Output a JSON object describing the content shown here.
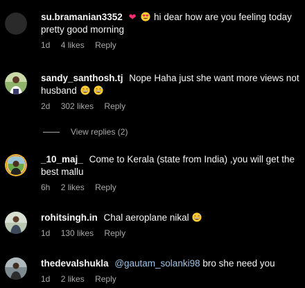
{
  "colors": {
    "background": "#000000",
    "text": "#f5f5f5",
    "meta": "#a8a8a8",
    "mention": "#9fc3e7",
    "heart": "#ff2d72"
  },
  "comments": [
    {
      "username": "su.bramanian3352",
      "text": "hi dear how are you feeling today pretty good morning",
      "emojis": [
        "red-heart-icon",
        "heart-eyes-icon"
      ],
      "age": "1d",
      "likes": "4 likes",
      "reply": "Reply"
    },
    {
      "username": "sandy_santhosh.tj",
      "text": "Nope Haha just she want more views not husband",
      "emojis": [
        "grinning-sweat-icon",
        "grinning-sweat-icon"
      ],
      "age": "2d",
      "likes": "302 likes",
      "reply": "Reply",
      "view_replies": "View replies (2)"
    },
    {
      "username": "_10_maj_",
      "text": "Come to Kerala (state from India) ,you will get the best mallu",
      "age": "6h",
      "likes": "2 likes",
      "reply": "Reply"
    },
    {
      "username": "rohitsingh.in",
      "text": "Chal aeroplane nikal",
      "emojis": [
        "grinning-sweat-icon"
      ],
      "age": "1d",
      "likes": "130 likes",
      "reply": "Reply"
    },
    {
      "username": "thedevalshukla",
      "mention": "@gautam_solanki98",
      "text": "bro she need you",
      "age": "1d",
      "likes": "2 likes",
      "reply": "Reply"
    }
  ]
}
